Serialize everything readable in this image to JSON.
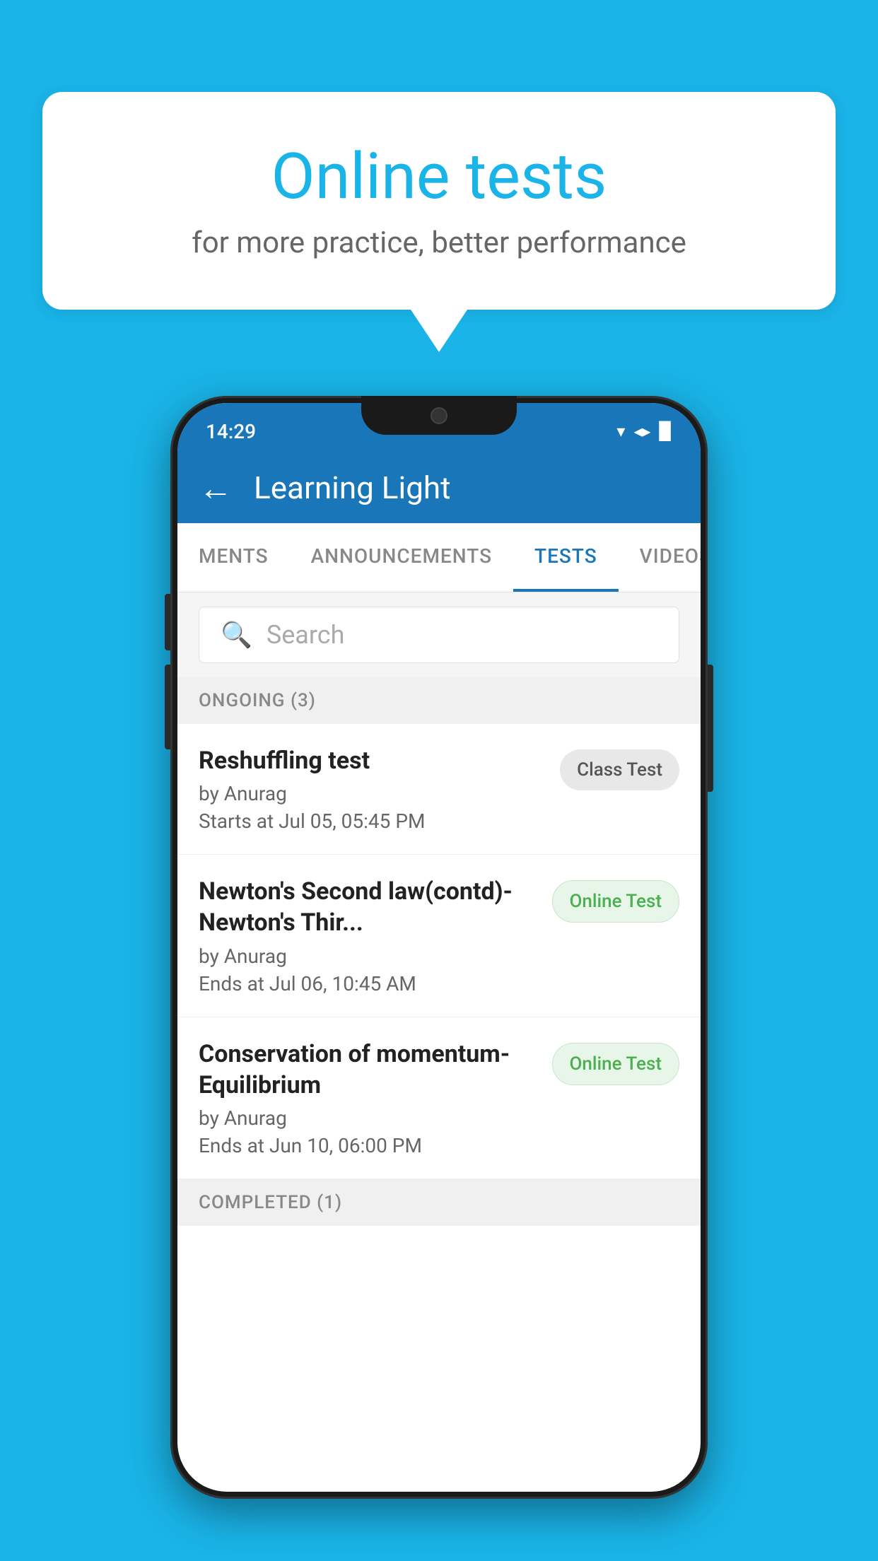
{
  "background_color": "#1ab4e8",
  "speech_bubble": {
    "title": "Online tests",
    "subtitle": "for more practice, better performance"
  },
  "status_bar": {
    "time": "14:29",
    "wifi_icon": "wifi-icon",
    "signal_icon": "signal-icon",
    "battery_icon": "battery-icon"
  },
  "app_bar": {
    "title": "Learning Light",
    "back_label": "←"
  },
  "tabs": [
    {
      "label": "MENTS",
      "active": false
    },
    {
      "label": "ANNOUNCEMENTS",
      "active": false
    },
    {
      "label": "TESTS",
      "active": true
    },
    {
      "label": "VIDEOS",
      "active": false
    }
  ],
  "search": {
    "placeholder": "Search"
  },
  "sections": [
    {
      "title": "ONGOING (3)",
      "items": [
        {
          "title": "Reshuffling test",
          "by": "by Anurag",
          "date": "Starts at  Jul 05, 05:45 PM",
          "badge": "Class Test",
          "badge_type": "class"
        },
        {
          "title": "Newton's Second law(contd)-Newton's Thir...",
          "by": "by Anurag",
          "date": "Ends at  Jul 06, 10:45 AM",
          "badge": "Online Test",
          "badge_type": "online"
        },
        {
          "title": "Conservation of momentum-Equilibrium",
          "by": "by Anurag",
          "date": "Ends at  Jun 10, 06:00 PM",
          "badge": "Online Test",
          "badge_type": "online"
        }
      ]
    }
  ],
  "completed_section": {
    "title": "COMPLETED (1)"
  }
}
